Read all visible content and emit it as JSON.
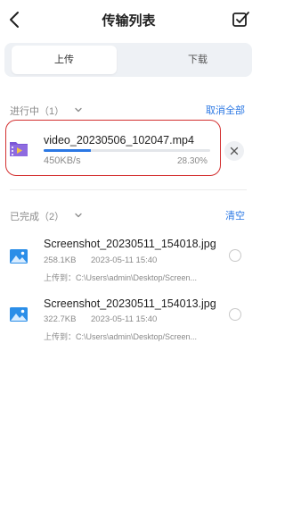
{
  "header": {
    "title": "传输列表",
    "back_icon": "back-chevron-icon",
    "select_icon": "multi-select-checkbox-icon"
  },
  "tabs": [
    {
      "label": "上传",
      "active": true
    },
    {
      "label": "下载",
      "active": false
    }
  ],
  "in_progress": {
    "label": "进行中（1）",
    "action": "取消全部",
    "items": [
      {
        "name": "video_20230506_102047.mp4",
        "speed": "450KB/s",
        "percent_text": "28.30%",
        "progress": 0.283,
        "icon": "video-file-icon"
      }
    ]
  },
  "completed": {
    "label": "已完成（2）",
    "action": "清空",
    "items": [
      {
        "name": "Screenshot_20230511_154018.jpg",
        "size": "258.1KB",
        "time": "2023-05-11 15:40",
        "dest": "上传到：C:\\Users\\admin\\Desktop/Screen...",
        "icon": "image-file-icon"
      },
      {
        "name": "Screenshot_20230511_154013.jpg",
        "size": "322.7KB",
        "time": "2023-05-11 15:40",
        "dest": "上传到：C:\\Users\\admin\\Desktop/Screen...",
        "icon": "image-file-icon"
      }
    ]
  },
  "colors": {
    "accent": "#2b78e4",
    "highlight_border": "#d32f2f",
    "video_icon": "#7b57d6"
  }
}
